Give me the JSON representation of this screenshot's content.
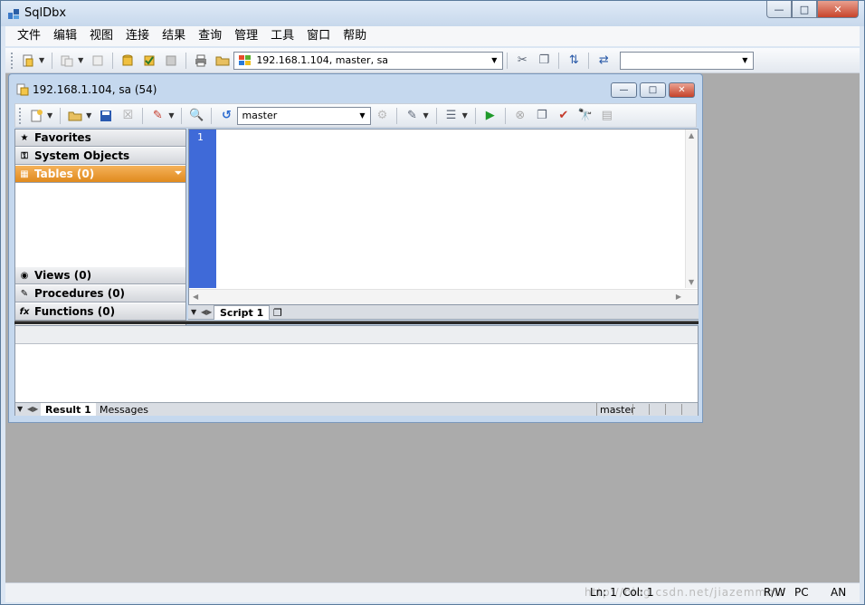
{
  "app": {
    "title": "SqlDbx",
    "window_buttons": [
      "—",
      "□",
      "✕"
    ]
  },
  "menu": [
    "文件",
    "编辑",
    "视图",
    "连接",
    "结果",
    "查询",
    "管理",
    "工具",
    "窗口",
    "帮助"
  ],
  "main_toolbar": {
    "connection_value": "192.168.1.104, master, sa",
    "extra_combo_value": ""
  },
  "child_window": {
    "title": "192.168.1.104, sa (54)",
    "window_buttons": [
      "—",
      "□",
      "✕"
    ],
    "database_value": "master"
  },
  "object_panel": {
    "items": [
      {
        "label": "Favorites",
        "icon": "star-icon"
      },
      {
        "label": "System Objects",
        "icon": "key-icon"
      },
      {
        "label": "Tables (0)",
        "icon": "table-icon",
        "active": true
      },
      {
        "label": "Views (0)",
        "icon": "view-icon"
      },
      {
        "label": "Procedures (0)",
        "icon": "procedure-icon"
      },
      {
        "label": "Functions (0)",
        "icon": "function-icon"
      }
    ]
  },
  "editor": {
    "line_numbers": [
      "1"
    ],
    "tabs": [
      {
        "label": "Script 1",
        "active": true
      }
    ]
  },
  "results": {
    "tabs": [
      {
        "label": "Result 1",
        "active": true
      },
      {
        "label": "Messages",
        "active": false
      }
    ],
    "database": "master"
  },
  "status": {
    "ln": "Ln: 1",
    "col": "Col: 1",
    "rw": "R/W",
    "pc": "PC",
    "an": "AN",
    "watermark": "http://blog.csdn.net/jiazemmmc"
  },
  "colors": {
    "active_panel": "#e8951f",
    "gutter": "#3f6ad8",
    "mdi_background": "#ababab"
  }
}
